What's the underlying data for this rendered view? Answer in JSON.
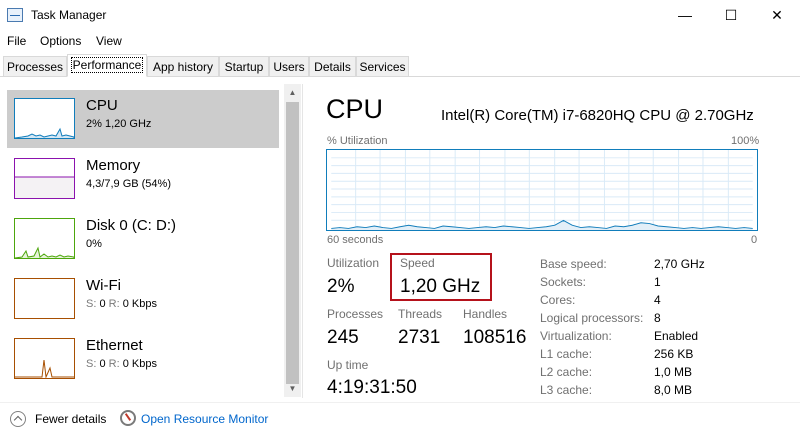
{
  "window": {
    "title": "Task Manager",
    "minimize": "—",
    "maximize": "☐",
    "close": "✕"
  },
  "menu": [
    "File",
    "Options",
    "View"
  ],
  "tabs": [
    "Processes",
    "Performance",
    "App history",
    "Startup",
    "Users",
    "Details",
    "Services"
  ],
  "active_tab": "Performance",
  "sidebar": {
    "items": [
      {
        "name": "CPU",
        "detail": "2% 1,20 GHz",
        "color": "#117dbb"
      },
      {
        "name": "Memory",
        "detail": "4,3/7,9 GB (54%)",
        "color": "#8b12ae"
      },
      {
        "name": "Disk 0 (C: D:)",
        "detail": "0%",
        "color": "#4da60c"
      },
      {
        "name": "Wi-Fi",
        "detail_label_s": "S:",
        "detail_s": "0",
        "detail_label_r": "R:",
        "detail_r": "0 Kbps",
        "color": "#a74f01"
      },
      {
        "name": "Ethernet",
        "detail_label_s": "S:",
        "detail_s": "0",
        "detail_label_r": "R:",
        "detail_r": "0 Kbps",
        "color": "#a74f01"
      }
    ]
  },
  "cpu": {
    "title": "CPU",
    "model": "Intel(R) Core(TM) i7-6820HQ CPU @ 2.70GHz",
    "graph_label": "% Utilization",
    "graph_max": "100%",
    "graph_time": "60 seconds",
    "graph_min": "0",
    "utilization_label": "Utilization",
    "utilization": "2%",
    "speed_label": "Speed",
    "speed": "1,20 GHz",
    "processes_label": "Processes",
    "processes": "245",
    "threads_label": "Threads",
    "threads": "2731",
    "handles_label": "Handles",
    "handles": "108516",
    "uptime_label": "Up time",
    "uptime": "4:19:31:50",
    "specs": [
      {
        "label": "Base speed:",
        "value": "2,70 GHz"
      },
      {
        "label": "Sockets:",
        "value": "1"
      },
      {
        "label": "Cores:",
        "value": "4"
      },
      {
        "label": "Logical processors:",
        "value": "8"
      },
      {
        "label": "Virtualization:",
        "value": "Enabled"
      },
      {
        "label": "L1 cache:",
        "value": "256 KB"
      },
      {
        "label": "L2 cache:",
        "value": "1,0 MB"
      },
      {
        "label": "L3 cache:",
        "value": "8,0 MB"
      }
    ],
    "utilization_history": [
      2,
      3,
      2,
      4,
      3,
      5,
      3,
      2,
      4,
      6,
      4,
      3,
      2,
      5,
      4,
      3,
      2,
      3,
      4,
      3,
      5,
      4,
      3,
      2,
      3,
      4,
      6,
      12,
      6,
      3,
      4,
      3,
      2,
      5,
      4,
      6,
      9,
      8,
      5,
      4,
      3,
      2,
      3,
      2,
      3,
      4,
      3,
      2,
      3,
      2
    ]
  },
  "footer": {
    "fewer_details": "Fewer details",
    "open_monitor": "Open Resource Monitor"
  }
}
